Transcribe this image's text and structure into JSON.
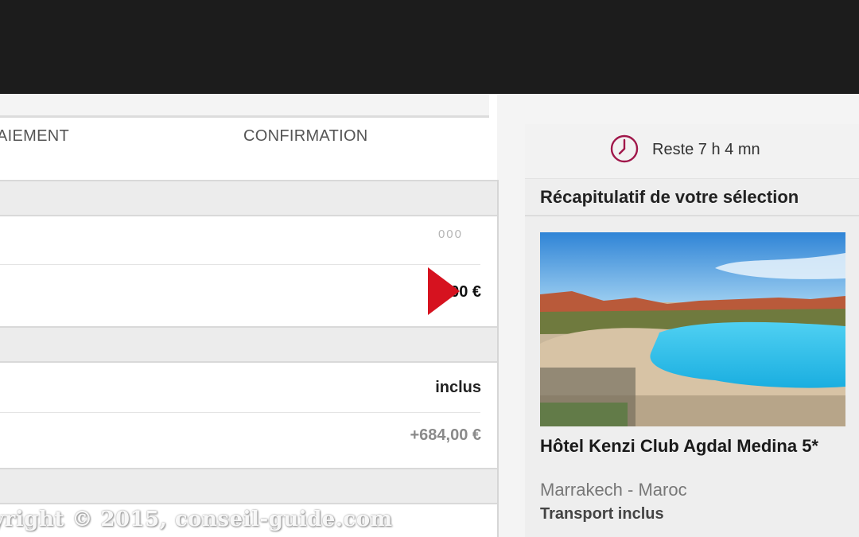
{
  "steps": {
    "payment": "AIEMENT",
    "confirmation": "CONFIRMATION"
  },
  "table": {
    "dots_value": "000",
    "price_value": "1 00 €",
    "included_value": "inclus",
    "extra_value": "+684,00 €"
  },
  "timer": {
    "icon": "clock-icon",
    "text": "Reste 7 h 4 mn"
  },
  "summary": {
    "title": "Récapitulatif de votre sélection",
    "hotel_name": "Hôtel Kenzi Club Agdal Medina 5*",
    "location": "Marrakech - Maroc",
    "transport": "Transport inclus"
  },
  "watermark": "yright © 2015, conseil-guide.com",
  "colors": {
    "topbar": "#1c1c1c",
    "cursor": "#d6121f",
    "clock": "#a0174a"
  }
}
